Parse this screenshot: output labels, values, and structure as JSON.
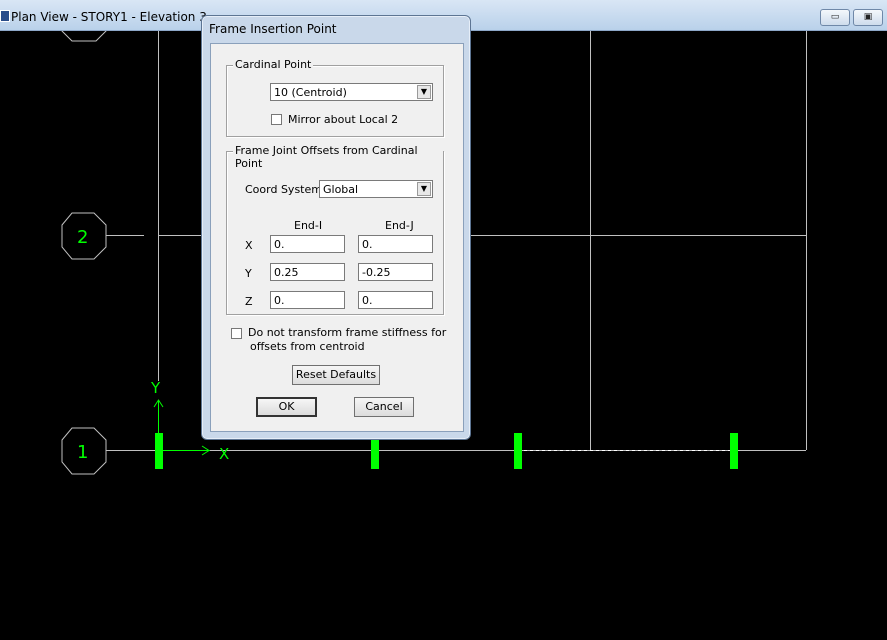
{
  "window": {
    "title": "Plan View - STORY1 - Elevation 3",
    "minimize_label": "▭",
    "restore_label": "▣"
  },
  "canvas": {
    "grid_bubbles": [
      "2",
      "1"
    ],
    "axis_x_label": "X",
    "axis_y_label": "Y",
    "line_color": "#c0c0c0",
    "frame_color": "#00ff00"
  },
  "dialog": {
    "title": "Frame Insertion Point",
    "cardinal": {
      "legend": "Cardinal Point",
      "selected": "10 (Centroid)",
      "mirror_label": "Mirror about Local 2",
      "mirror_checked": false
    },
    "offsets": {
      "legend": "Frame Joint Offsets from Cardinal Point",
      "coord_label": "Coord System",
      "coord_selected": "Global",
      "col_end_i": "End-I",
      "col_end_j": "End-J",
      "rows": [
        {
          "axis": "X",
          "end_i": "0.",
          "end_j": "0."
        },
        {
          "axis": "Y",
          "end_i": "0.25",
          "end_j": "-0.25"
        },
        {
          "axis": "Z",
          "end_i": "0.",
          "end_j": "0."
        }
      ]
    },
    "no_transform_label_1": "Do not transform frame stiffness for",
    "no_transform_label_2": "offsets from centroid",
    "no_transform_checked": false,
    "reset_label": "Reset Defaults",
    "ok_label": "OK",
    "cancel_label": "Cancel"
  }
}
